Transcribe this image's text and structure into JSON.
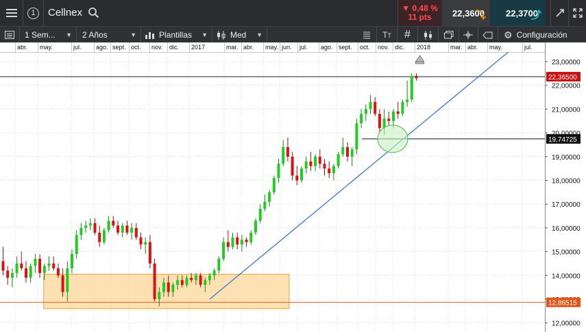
{
  "header": {
    "menu_icon": "hamburger-icon",
    "badge": "1",
    "symbol": "Cellnex",
    "search_icon": "search-icon",
    "change_pct": "▼ 0,48 %",
    "change_pts": "11 pts",
    "bid": "22,3600",
    "ask": "22,3700",
    "bid_color": "#e08a10",
    "ask_color": "#1cb7c8",
    "down_color": "#ff4a4a"
  },
  "toolbar": {
    "period": "1 Sem...",
    "range": "2 Años",
    "templates": "Plantillas",
    "med": "Med",
    "config": "Configuración"
  },
  "months": [
    "abr.",
    "may.",
    "jul.",
    "ago.",
    "sept.",
    "oct.",
    "nov.",
    "dic.",
    "2017",
    "mar.",
    "abr.",
    "may.",
    "jun.",
    "jul.",
    "ago.",
    "sept.",
    "oct.",
    "nov.",
    "dic.",
    "2018",
    "mar.",
    "abr.",
    "may.",
    "jul."
  ],
  "price_axis": {
    "labels": [
      "23,00000",
      "22,00000",
      "21,00000",
      "20,00000",
      "19,00000",
      "18,00000",
      "17,00000",
      "16,00000",
      "15,00000",
      "14,00000",
      "13,00000",
      "12,00000"
    ],
    "current": "22,36500",
    "level_1": "19,74725",
    "level_2": "12,86515"
  },
  "chart_data": {
    "type": "candlestick",
    "ylim": [
      11.7,
      23.4
    ],
    "current_price": 22.365,
    "up_color": "#22cc22",
    "down_color": "#dd1111",
    "candles": [
      [
        14.6,
        15.2,
        14.0,
        14.2
      ],
      [
        14.2,
        14.4,
        13.6,
        13.9
      ],
      [
        13.9,
        14.3,
        13.5,
        14.1
      ],
      [
        14.1,
        14.8,
        13.9,
        14.5
      ],
      [
        14.5,
        15.0,
        14.2,
        14.3
      ],
      [
        14.3,
        14.6,
        13.7,
        13.9
      ],
      [
        13.9,
        14.5,
        13.7,
        14.4
      ],
      [
        14.4,
        14.9,
        14.1,
        14.7
      ],
      [
        14.7,
        14.9,
        13.9,
        14.1
      ],
      [
        14.1,
        14.5,
        13.8,
        14.4
      ],
      [
        14.4,
        14.8,
        14.2,
        14.5
      ],
      [
        14.5,
        14.8,
        14.2,
        14.3
      ],
      [
        14.3,
        14.5,
        13.9,
        14.0
      ],
      [
        14.0,
        14.3,
        13.1,
        13.3
      ],
      [
        13.3,
        14.6,
        12.9,
        14.3
      ],
      [
        14.3,
        15.1,
        14.1,
        14.9
      ],
      [
        14.9,
        15.9,
        14.7,
        15.7
      ],
      [
        15.7,
        16.2,
        15.5,
        16.0
      ],
      [
        16.0,
        16.3,
        15.8,
        16.1
      ],
      [
        16.1,
        16.4,
        15.9,
        16.2
      ],
      [
        16.2,
        16.4,
        15.7,
        15.8
      ],
      [
        15.8,
        16.1,
        15.2,
        15.4
      ],
      [
        15.4,
        16.0,
        15.3,
        15.9
      ],
      [
        15.9,
        16.5,
        15.8,
        16.3
      ],
      [
        16.3,
        16.5,
        16.0,
        16.1
      ],
      [
        16.1,
        16.3,
        15.7,
        15.8
      ],
      [
        15.8,
        16.2,
        15.6,
        16.1
      ],
      [
        16.1,
        16.3,
        15.7,
        15.8
      ],
      [
        15.8,
        16.2,
        15.5,
        16.0
      ],
      [
        16.0,
        16.2,
        15.5,
        15.6
      ],
      [
        15.6,
        15.8,
        15.1,
        15.3
      ],
      [
        15.3,
        15.6,
        14.9,
        15.4
      ],
      [
        15.4,
        15.7,
        14.3,
        14.5
      ],
      [
        14.5,
        14.7,
        12.9,
        13.0
      ],
      [
        13.0,
        13.5,
        12.7,
        13.3
      ],
      [
        13.3,
        13.9,
        13.1,
        13.7
      ],
      [
        13.7,
        14.0,
        13.1,
        13.3
      ],
      [
        13.3,
        13.7,
        13.1,
        13.6
      ],
      [
        13.6,
        14.0,
        13.4,
        13.8
      ],
      [
        13.8,
        14.0,
        13.5,
        13.6
      ],
      [
        13.6,
        14.0,
        13.5,
        13.9
      ],
      [
        13.9,
        14.1,
        13.7,
        13.8
      ],
      [
        13.8,
        14.1,
        13.6,
        14.0
      ],
      [
        14.0,
        14.1,
        13.5,
        13.6
      ],
      [
        13.6,
        13.9,
        13.3,
        13.8
      ],
      [
        13.8,
        14.1,
        13.6,
        14.0
      ],
      [
        14.0,
        14.3,
        13.8,
        14.2
      ],
      [
        14.2,
        14.8,
        14.1,
        14.7
      ],
      [
        14.7,
        15.6,
        14.6,
        15.4
      ],
      [
        15.4,
        15.9,
        15.0,
        15.2
      ],
      [
        15.2,
        15.8,
        15.1,
        15.6
      ],
      [
        15.6,
        15.8,
        15.1,
        15.3
      ],
      [
        15.3,
        15.7,
        15.0,
        15.5
      ],
      [
        15.5,
        15.6,
        15.2,
        15.4
      ],
      [
        15.4,
        15.9,
        15.3,
        15.8
      ],
      [
        15.8,
        16.4,
        15.7,
        16.3
      ],
      [
        16.3,
        17.0,
        16.2,
        16.8
      ],
      [
        16.8,
        17.4,
        16.7,
        17.1
      ],
      [
        17.1,
        17.6,
        16.9,
        17.5
      ],
      [
        17.5,
        18.2,
        17.4,
        18.1
      ],
      [
        18.1,
        18.9,
        17.9,
        18.7
      ],
      [
        18.7,
        19.7,
        18.6,
        19.4
      ],
      [
        19.4,
        19.8,
        18.8,
        19.0
      ],
      [
        19.0,
        19.2,
        18.0,
        18.2
      ],
      [
        18.2,
        18.6,
        17.8,
        18.0
      ],
      [
        18.0,
        18.6,
        17.9,
        18.5
      ],
      [
        18.5,
        19.0,
        18.3,
        18.8
      ],
      [
        18.8,
        19.2,
        18.4,
        18.6
      ],
      [
        18.6,
        19.1,
        18.4,
        19.0
      ],
      [
        19.0,
        19.3,
        18.5,
        18.7
      ],
      [
        18.7,
        18.9,
        18.2,
        18.5
      ],
      [
        18.5,
        18.8,
        18.1,
        18.3
      ],
      [
        18.3,
        18.7,
        18.0,
        18.6
      ],
      [
        18.6,
        19.2,
        18.5,
        19.1
      ],
      [
        19.1,
        19.8,
        19.0,
        19.4
      ],
      [
        19.4,
        19.6,
        18.8,
        19.0
      ],
      [
        19.0,
        19.4,
        18.6,
        19.3
      ],
      [
        19.3,
        20.6,
        19.1,
        20.4
      ],
      [
        20.4,
        21.0,
        20.2,
        20.8
      ],
      [
        20.8,
        21.2,
        20.5,
        21.0
      ],
      [
        21.0,
        21.6,
        20.8,
        21.3
      ],
      [
        21.3,
        21.5,
        20.7,
        20.8
      ],
      [
        20.8,
        21.0,
        20.0,
        20.2
      ],
      [
        20.2,
        21.0,
        19.9,
        20.6
      ],
      [
        20.6,
        20.9,
        20.3,
        20.5
      ],
      [
        20.5,
        21.0,
        20.2,
        20.9
      ],
      [
        20.9,
        21.3,
        20.6,
        20.8
      ],
      [
        20.8,
        21.4,
        20.7,
        21.3
      ],
      [
        21.3,
        22.2,
        21.1,
        21.4
      ],
      [
        21.4,
        22.5,
        21.3,
        22.4
      ],
      [
        22.4,
        22.5,
        22.2,
        22.3
      ]
    ],
    "trendline": {
      "from": [
        45,
        13.0
      ],
      "to": [
        110,
        23.4
      ],
      "color": "#3a78d0"
    },
    "zone": {
      "from_index": 9,
      "to_index": 62,
      "low": 12.6,
      "high": 14.05,
      "fill": "#fcd79a",
      "stroke": "#e8a33a"
    },
    "circle": {
      "index": 85,
      "price": 19.75,
      "fill": "#c8f2c2",
      "stroke": "#4ac04a"
    }
  }
}
